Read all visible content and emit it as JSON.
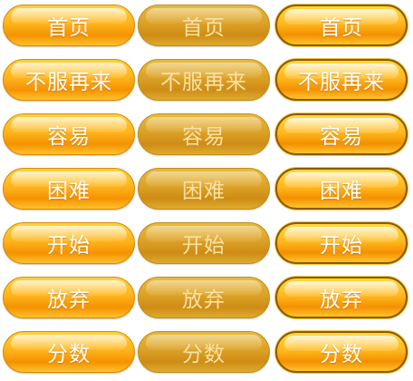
{
  "colors": {
    "normal_top": "#ffd23a",
    "normal_bottom": "#f49200",
    "disabled_top": "#e8bb3c",
    "disabled_text": "#f7e2a6",
    "hover_border": "#8c5a00",
    "text": "#ffffff"
  },
  "states": [
    "normal",
    "disabled",
    "hover"
  ],
  "buttons": [
    {
      "label": "首页"
    },
    {
      "label": "不服再来"
    },
    {
      "label": "容易"
    },
    {
      "label": "困难"
    },
    {
      "label": "开始"
    },
    {
      "label": "放弃"
    },
    {
      "label": "分数"
    }
  ]
}
